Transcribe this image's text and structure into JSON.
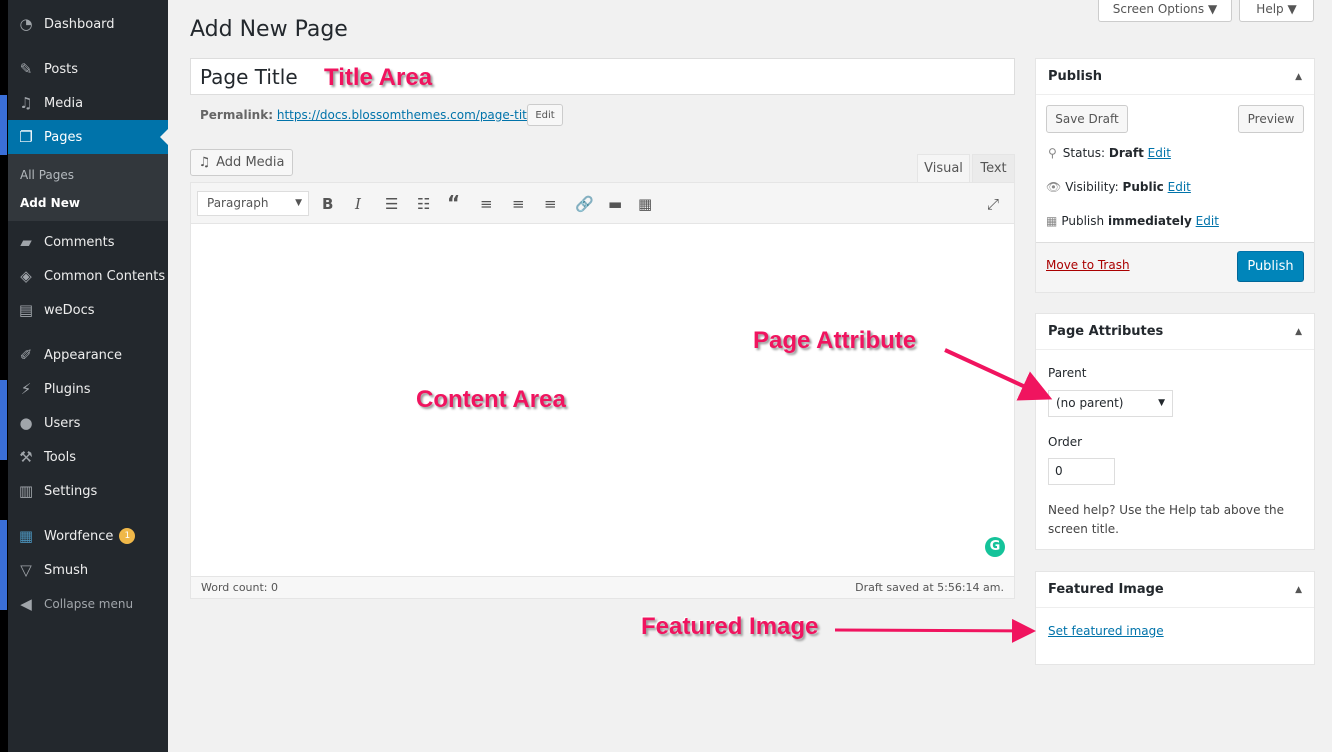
{
  "sidebar": {
    "items": [
      {
        "label": "Dashboard",
        "icon": "dashboard-icon"
      },
      {
        "label": "Posts",
        "icon": "pin-icon"
      },
      {
        "label": "Media",
        "icon": "media-icon"
      },
      {
        "label": "Pages",
        "icon": "pages-icon"
      },
      {
        "label": "Comments",
        "icon": "comment-icon"
      },
      {
        "label": "Common Contents",
        "icon": "tag-icon"
      },
      {
        "label": "weDocs",
        "icon": "doc-icon"
      },
      {
        "label": "Appearance",
        "icon": "brush-icon"
      },
      {
        "label": "Plugins",
        "icon": "plug-icon"
      },
      {
        "label": "Users",
        "icon": "user-icon"
      },
      {
        "label": "Tools",
        "icon": "wrench-icon"
      },
      {
        "label": "Settings",
        "icon": "settings-icon"
      },
      {
        "label": "Wordfence",
        "icon": "wordfence-icon",
        "badge": "1"
      },
      {
        "label": "Smush",
        "icon": "smush-icon"
      },
      {
        "label": "Collapse menu",
        "icon": "collapse-icon"
      }
    ],
    "submenu": [
      "All Pages",
      "Add New"
    ]
  },
  "header": {
    "title": "Add New Page",
    "screen_options": "Screen Options ▼",
    "help": "Help ▼"
  },
  "editor": {
    "title_value": "Page Title",
    "permalink_label": "Permalink:",
    "permalink_url": "https://docs.blossomthemes.com/page-title/",
    "edit": "Edit",
    "add_media": "Add Media",
    "tab_visual": "Visual",
    "tab_text": "Text",
    "format": "Paragraph",
    "word_count": "Word count: 0",
    "draft_saved": "Draft saved at 5:56:14 am."
  },
  "publish": {
    "title": "Publish",
    "save_draft": "Save Draft",
    "preview": "Preview",
    "status_label": "Status:",
    "status": "Draft",
    "visibility_label": "Visibility:",
    "visibility": "Public",
    "publish_label": "Publish",
    "publish_when": "immediately",
    "edit": "Edit",
    "trash": "Move to Trash",
    "publish_btn": "Publish"
  },
  "attributes": {
    "title": "Page Attributes",
    "parent_label": "Parent",
    "parent_value": "(no parent)",
    "order_label": "Order",
    "order_value": "0",
    "help": "Need help? Use the Help tab above the screen title."
  },
  "featured": {
    "title": "Featured Image",
    "link": "Set featured image"
  },
  "annotations": {
    "title_area": "Title Area",
    "content_area": "Content Area",
    "page_attribute": "Page Attribute",
    "featured_image": "Featured Image"
  },
  "colors": {
    "accent": "#0073aa",
    "annotation": "#f0145f",
    "sidebar": "#23282d"
  }
}
